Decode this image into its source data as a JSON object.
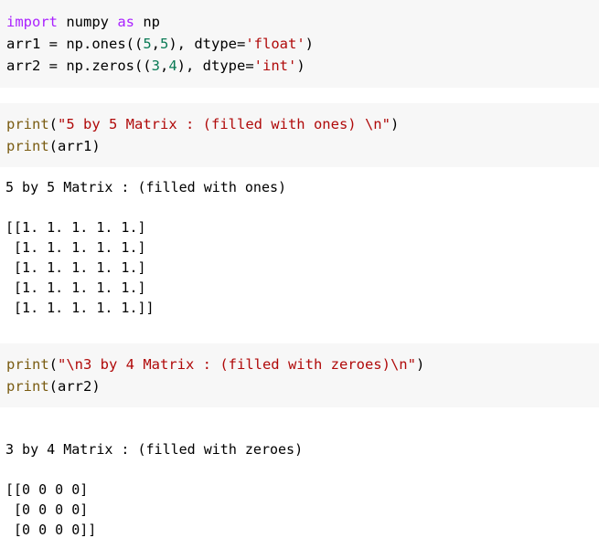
{
  "cell1": {
    "line1": {
      "kw_import": "import",
      "mod": " numpy ",
      "kw_as": "as",
      "alias": " np"
    },
    "line2": {
      "pre": "arr1 = np.ones((",
      "n1": "5",
      "comma": ",",
      "n2": "5",
      "mid": "), dtype=",
      "str": "'float'",
      "post": ")"
    },
    "line3": {
      "pre": "arr2 = np.zeros((",
      "n1": "3",
      "comma": ",",
      "n2": "4",
      "mid": "), dtype=",
      "str": "'int'",
      "post": ")"
    }
  },
  "cell2": {
    "line1": {
      "fn": "print",
      "open": "(",
      "str": "\"5 by 5 Matrix : (filled with ones) \\n\"",
      "close": ")"
    },
    "line2": {
      "fn": "print",
      "rest": "(arr1)"
    }
  },
  "output1": {
    "heading": "5 by 5 Matrix : (filled with ones)",
    "rows": [
      "[[1. 1. 1. 1. 1.]",
      " [1. 1. 1. 1. 1.]",
      " [1. 1. 1. 1. 1.]",
      " [1. 1. 1. 1. 1.]",
      " [1. 1. 1. 1. 1.]]"
    ]
  },
  "cell3": {
    "line1": {
      "fn": "print",
      "open": "(",
      "str": "\"\\n3 by 4 Matrix : (filled with zeroes)\\n\"",
      "close": ")"
    },
    "line2": {
      "fn": "print",
      "rest": "(arr2)"
    }
  },
  "output2": {
    "heading": "3 by 4 Matrix : (filled with zeroes)",
    "rows": [
      "[[0 0 0 0]",
      " [0 0 0 0]",
      " [0 0 0 0]]"
    ]
  }
}
